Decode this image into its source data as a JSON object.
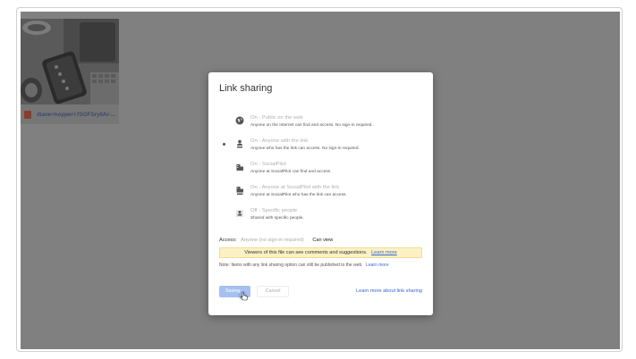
{
  "tile": {
    "file_name": "diane+hopper+7SOFSry6Ar-...",
    "icon": "image-file-icon"
  },
  "dialog": {
    "title": "Link sharing",
    "options": [
      {
        "title": "On - Public on the web",
        "description": "Anyone on the Internet can find and access. No sign-in required.",
        "icon": "globe-icon",
        "selected": false
      },
      {
        "title": "On - Anyone with the link",
        "description": "Anyone who has the link can access. No sign-in required.",
        "icon": "person-link-icon",
        "selected": true
      },
      {
        "title": "On - SocialPilot",
        "description": "Anyone at SocialPilot can find and access.",
        "icon": "building-icon",
        "selected": false
      },
      {
        "title": "On - Anyone at SocialPilot with the link",
        "description": "Anyone at SocialPilot who has the link can access.",
        "icon": "building-link-icon",
        "selected": false
      },
      {
        "title": "Off - Specific people",
        "description": "Shared with specific people.",
        "icon": "person-lock-icon",
        "selected": false
      }
    ],
    "access": {
      "label": "Access:",
      "value": "Anyone (no sign-in required)",
      "permission": "Can view"
    },
    "banner": {
      "text": "Viewers of this file can see comments and suggestions.",
      "link": "Learn more"
    },
    "note": {
      "text": "Note: Items with any link sharing option can still be published to the web.",
      "link": "Learn more"
    },
    "buttons": {
      "done": "Saving...",
      "cancel": "Cancel"
    },
    "learn_more": "Learn more about link sharing"
  },
  "colors": {
    "overlay": "#808080",
    "link": "#3367d6",
    "banner_bg": "#fcf1c5",
    "primary_button": "#a6c1f0"
  }
}
